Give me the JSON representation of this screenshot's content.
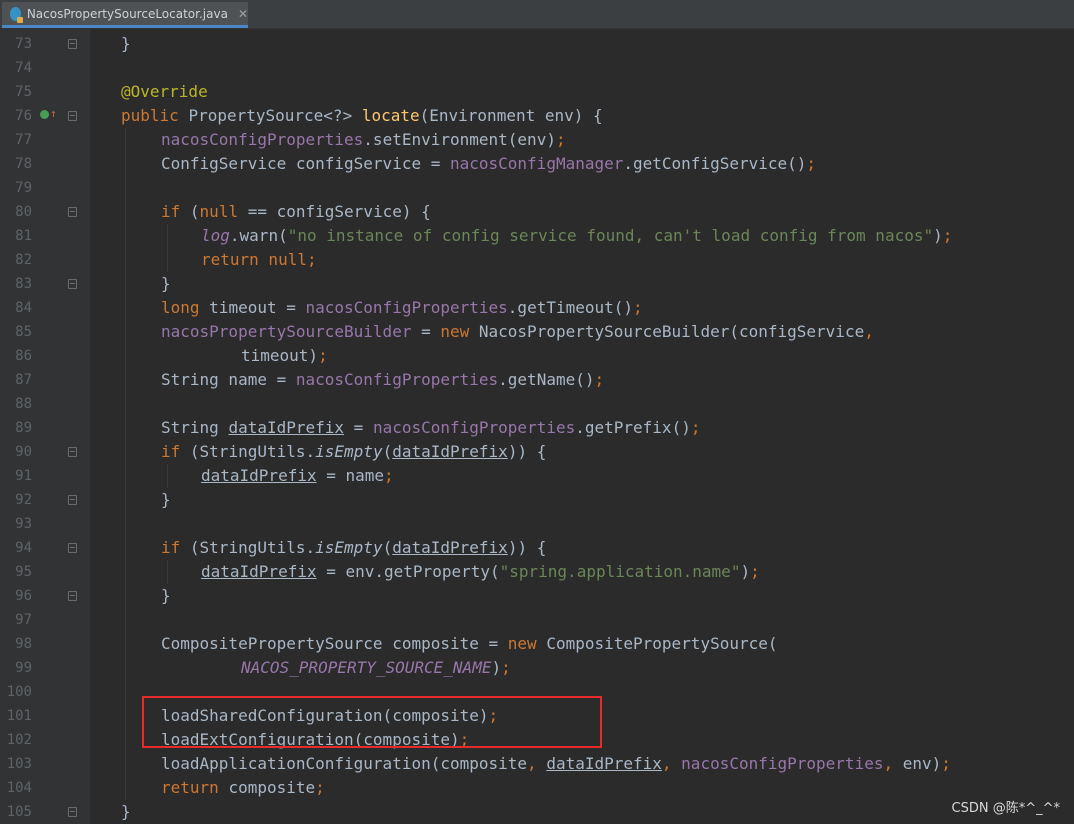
{
  "tab": {
    "title": "NacosPropertySourceLocator.java",
    "close": "✕",
    "icon": "java-class-icon"
  },
  "colors": {
    "keyword": "#cc7832",
    "field": "#9876aa",
    "method_decl": "#ffc66d",
    "annotation": "#bbb529",
    "string": "#6a8759",
    "plain": "#a9b7c6",
    "highlight_box": "#e62b2b"
  },
  "lines": [
    {
      "n": "73",
      "fold": true,
      "marker": false,
      "tokens": [
        {
          "t": "}",
          "c": "p"
        }
      ],
      "indent": 0
    },
    {
      "n": "74",
      "fold": false,
      "marker": false,
      "tokens": [],
      "indent": 0
    },
    {
      "n": "75",
      "fold": false,
      "marker": false,
      "tokens": [
        {
          "t": "@Override",
          "c": "ann"
        }
      ],
      "indent": 0
    },
    {
      "n": "76",
      "fold": true,
      "marker": true,
      "tokens": [
        {
          "t": "public ",
          "c": "kw"
        },
        {
          "t": "PropertySource<?> ",
          "c": "p"
        },
        {
          "t": "locate",
          "c": "fn"
        },
        {
          "t": "(Environment env) {",
          "c": "p"
        }
      ],
      "indent": 0
    },
    {
      "n": "77",
      "fold": false,
      "marker": false,
      "tokens": [
        {
          "t": "nacosConfigProperties",
          "c": "fld"
        },
        {
          "t": ".setEnvironment(env)",
          "c": "p"
        },
        {
          "t": ";",
          "c": "kw"
        }
      ],
      "indent": 1
    },
    {
      "n": "78",
      "fold": false,
      "marker": false,
      "tokens": [
        {
          "t": "ConfigService configService = ",
          "c": "p"
        },
        {
          "t": "nacosConfigManager",
          "c": "fld"
        },
        {
          "t": ".getConfigService()",
          "c": "p"
        },
        {
          "t": ";",
          "c": "kw"
        }
      ],
      "indent": 1
    },
    {
      "n": "79",
      "fold": false,
      "marker": false,
      "tokens": [],
      "indent": 1
    },
    {
      "n": "80",
      "fold": true,
      "marker": false,
      "tokens": [
        {
          "t": "if ",
          "c": "kw"
        },
        {
          "t": "(",
          "c": "p"
        },
        {
          "t": "null ",
          "c": "kw"
        },
        {
          "t": "== configService) {",
          "c": "p"
        }
      ],
      "indent": 1
    },
    {
      "n": "81",
      "fold": false,
      "marker": false,
      "tokens": [
        {
          "t": "log",
          "c": "fld-i"
        },
        {
          "t": ".warn(",
          "c": "p"
        },
        {
          "t": "\"no instance of config service found, can't load config from nacos\"",
          "c": "str"
        },
        {
          "t": ")",
          "c": "p"
        },
        {
          "t": ";",
          "c": "kw"
        }
      ],
      "indent": 2
    },
    {
      "n": "82",
      "fold": false,
      "marker": false,
      "tokens": [
        {
          "t": "return null;",
          "c": "kw"
        }
      ],
      "indent": 2
    },
    {
      "n": "83",
      "fold": true,
      "marker": false,
      "tokens": [
        {
          "t": "}",
          "c": "p"
        }
      ],
      "indent": 1
    },
    {
      "n": "84",
      "fold": false,
      "marker": false,
      "tokens": [
        {
          "t": "long ",
          "c": "kw"
        },
        {
          "t": "timeout = ",
          "c": "p"
        },
        {
          "t": "nacosConfigProperties",
          "c": "fld"
        },
        {
          "t": ".getTimeout()",
          "c": "p"
        },
        {
          "t": ";",
          "c": "kw"
        }
      ],
      "indent": 1
    },
    {
      "n": "85",
      "fold": false,
      "marker": false,
      "tokens": [
        {
          "t": "nacosPropertySourceBuilder",
          "c": "fld"
        },
        {
          "t": " = ",
          "c": "p"
        },
        {
          "t": "new ",
          "c": "kw"
        },
        {
          "t": "NacosPropertySourceBuilder(configService",
          "c": "p"
        },
        {
          "t": ",",
          "c": "kw"
        }
      ],
      "indent": 1
    },
    {
      "n": "86",
      "fold": false,
      "marker": false,
      "tokens": [
        {
          "t": "timeout)",
          "c": "p"
        },
        {
          "t": ";",
          "c": "kw"
        }
      ],
      "indent": 3
    },
    {
      "n": "87",
      "fold": false,
      "marker": false,
      "tokens": [
        {
          "t": "String name = ",
          "c": "p"
        },
        {
          "t": "nacosConfigProperties",
          "c": "fld"
        },
        {
          "t": ".getName()",
          "c": "p"
        },
        {
          "t": ";",
          "c": "kw"
        }
      ],
      "indent": 1
    },
    {
      "n": "88",
      "fold": false,
      "marker": false,
      "tokens": [],
      "indent": 1
    },
    {
      "n": "89",
      "fold": false,
      "marker": false,
      "tokens": [
        {
          "t": "String ",
          "c": "p"
        },
        {
          "t": "dataIdPrefix",
          "c": "ul"
        },
        {
          "t": " = ",
          "c": "p"
        },
        {
          "t": "nacosConfigProperties",
          "c": "fld"
        },
        {
          "t": ".getPrefix()",
          "c": "p"
        },
        {
          "t": ";",
          "c": "kw"
        }
      ],
      "indent": 1
    },
    {
      "n": "90",
      "fold": true,
      "marker": false,
      "tokens": [
        {
          "t": "if ",
          "c": "kw"
        },
        {
          "t": "(StringUtils.",
          "c": "p"
        },
        {
          "t": "isEmpty",
          "c": "i"
        },
        {
          "t": "(",
          "c": "p"
        },
        {
          "t": "dataIdPrefix",
          "c": "ul"
        },
        {
          "t": ")) {",
          "c": "p"
        }
      ],
      "indent": 1
    },
    {
      "n": "91",
      "fold": false,
      "marker": false,
      "tokens": [
        {
          "t": "dataIdPrefix",
          "c": "ul"
        },
        {
          "t": " = name",
          "c": "p"
        },
        {
          "t": ";",
          "c": "kw"
        }
      ],
      "indent": 2
    },
    {
      "n": "92",
      "fold": true,
      "marker": false,
      "tokens": [
        {
          "t": "}",
          "c": "p"
        }
      ],
      "indent": 1
    },
    {
      "n": "93",
      "fold": false,
      "marker": false,
      "tokens": [],
      "indent": 1
    },
    {
      "n": "94",
      "fold": true,
      "marker": false,
      "tokens": [
        {
          "t": "if ",
          "c": "kw"
        },
        {
          "t": "(StringUtils.",
          "c": "p"
        },
        {
          "t": "isEmpty",
          "c": "i"
        },
        {
          "t": "(",
          "c": "p"
        },
        {
          "t": "dataIdPrefix",
          "c": "ul"
        },
        {
          "t": ")) {",
          "c": "p"
        }
      ],
      "indent": 1
    },
    {
      "n": "95",
      "fold": false,
      "marker": false,
      "tokens": [
        {
          "t": "dataIdPrefix",
          "c": "ul"
        },
        {
          "t": " = env.getProperty(",
          "c": "p"
        },
        {
          "t": "\"spring.application.name\"",
          "c": "str"
        },
        {
          "t": ")",
          "c": "p"
        },
        {
          "t": ";",
          "c": "kw"
        }
      ],
      "indent": 2
    },
    {
      "n": "96",
      "fold": true,
      "marker": false,
      "tokens": [
        {
          "t": "}",
          "c": "p"
        }
      ],
      "indent": 1
    },
    {
      "n": "97",
      "fold": false,
      "marker": false,
      "tokens": [],
      "indent": 1
    },
    {
      "n": "98",
      "fold": false,
      "marker": false,
      "tokens": [
        {
          "t": "CompositePropertySource composite = ",
          "c": "p"
        },
        {
          "t": "new ",
          "c": "kw"
        },
        {
          "t": "CompositePropertySource(",
          "c": "p"
        }
      ],
      "indent": 1
    },
    {
      "n": "99",
      "fold": false,
      "marker": false,
      "tokens": [
        {
          "t": "NACOS_PROPERTY_SOURCE_NAME",
          "c": "fld-i"
        },
        {
          "t": ")",
          "c": "p"
        },
        {
          "t": ";",
          "c": "kw"
        }
      ],
      "indent": 3
    },
    {
      "n": "100",
      "fold": false,
      "marker": false,
      "tokens": [],
      "indent": 1
    },
    {
      "n": "101",
      "fold": false,
      "marker": false,
      "tokens": [
        {
          "t": "loadSharedConfiguration(composite)",
          "c": "p"
        },
        {
          "t": ";",
          "c": "kw"
        }
      ],
      "indent": 1
    },
    {
      "n": "102",
      "fold": false,
      "marker": false,
      "tokens": [
        {
          "t": "loadExtConfiguration(composite)",
          "c": "p"
        },
        {
          "t": ";",
          "c": "kw"
        }
      ],
      "indent": 1
    },
    {
      "n": "103",
      "fold": false,
      "marker": false,
      "tokens": [
        {
          "t": "loadApplicationConfiguration(composite",
          "c": "p"
        },
        {
          "t": ", ",
          "c": "kw"
        },
        {
          "t": "dataIdPrefix",
          "c": "ul"
        },
        {
          "t": ", ",
          "c": "kw"
        },
        {
          "t": "nacosConfigProperties",
          "c": "fld"
        },
        {
          "t": ", ",
          "c": "kw"
        },
        {
          "t": "env)",
          "c": "p"
        },
        {
          "t": ";",
          "c": "kw"
        }
      ],
      "indent": 1
    },
    {
      "n": "104",
      "fold": false,
      "marker": false,
      "tokens": [
        {
          "t": "return ",
          "c": "kw"
        },
        {
          "t": "composite",
          "c": "p"
        },
        {
          "t": ";",
          "c": "kw"
        }
      ],
      "indent": 1
    },
    {
      "n": "105",
      "fold": true,
      "marker": false,
      "tokens": [
        {
          "t": "}",
          "c": "p"
        }
      ],
      "indent": 0
    }
  ],
  "watermark": "CSDN @陈*^_^*"
}
